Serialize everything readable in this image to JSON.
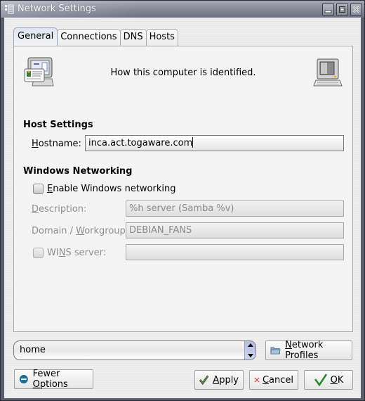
{
  "window": {
    "title": "Network Settings",
    "controls": [
      "minimize",
      "maximize",
      "close"
    ]
  },
  "tabs": [
    {
      "label": "General",
      "active": true
    },
    {
      "label": "Connections",
      "active": false
    },
    {
      "label": "DNS",
      "active": false
    },
    {
      "label": "Hosts",
      "active": false
    }
  ],
  "general": {
    "header_text": "How this computer is identified.",
    "host_settings": {
      "title": "Host Settings",
      "hostname_label_mnemonic": "H",
      "hostname_label_rest": "ostname:",
      "hostname_value": "inca.act.togaware.com"
    },
    "windows_networking": {
      "title": "Windows Networking",
      "enable_label_mnemonic": "E",
      "enable_label_rest": "nable Windows networking",
      "enable_checked": false,
      "description_label_mnemonic": "D",
      "description_label_rest": "escription:",
      "description_value": "%h server (Samba %v)",
      "workgroup_label_pre": "Domain / ",
      "workgroup_label_mnemonic": "W",
      "workgroup_label_rest": "orkgroup:",
      "workgroup_value": "DEBIAN_FANS",
      "wins_label_pre": "WI",
      "wins_label_mnemonic": "N",
      "wins_label_rest": "S server:",
      "wins_checked": false,
      "wins_value": ""
    }
  },
  "footer": {
    "profile_value": "home",
    "network_profiles_mnemonic": "N",
    "network_profiles_rest": "etwork Profiles",
    "fewer_options_pre": "Fewer ",
    "fewer_options_mnemonic": "O",
    "fewer_options_rest": "ptions",
    "apply_mnemonic": "A",
    "apply_rest": "pply",
    "cancel_mnemonic": "C",
    "cancel_rest": "ancel",
    "ok_mnemonic": "O",
    "ok_rest": "K"
  },
  "colors": {
    "apply_check": "#3a7a2a",
    "cancel_x": "#e01818",
    "ok_check": "#2a8a2a",
    "fewer_icon": "#1a6e96"
  }
}
